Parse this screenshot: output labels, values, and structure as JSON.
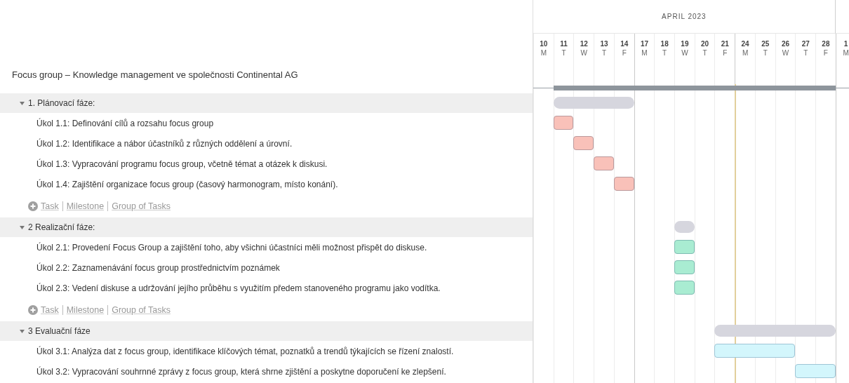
{
  "months": [
    {
      "label": "APRIL 2023"
    }
  ],
  "days": [
    {
      "day": "10",
      "weekday": "M"
    },
    {
      "day": "11",
      "weekday": "T"
    },
    {
      "day": "12",
      "weekday": "W"
    },
    {
      "day": "13",
      "weekday": "T"
    },
    {
      "day": "14",
      "weekday": "F"
    },
    {
      "day": "17",
      "weekday": "M"
    },
    {
      "day": "18",
      "weekday": "T"
    },
    {
      "day": "19",
      "weekday": "W"
    },
    {
      "day": "20",
      "weekday": "T"
    },
    {
      "day": "21",
      "weekday": "F"
    },
    {
      "day": "24",
      "weekday": "M"
    },
    {
      "day": "25",
      "weekday": "T"
    },
    {
      "day": "26",
      "weekday": "W"
    },
    {
      "day": "27",
      "weekday": "T"
    },
    {
      "day": "28",
      "weekday": "F"
    },
    {
      "day": "1",
      "weekday": "M"
    }
  ],
  "project": {
    "title": "Focus group – Knowledge management ve společnosti Continental AG"
  },
  "groups": [
    {
      "label": "1. Plánovací fáze:",
      "expanded": true,
      "tasks": [
        {
          "label": "Úkol 1.1: Definování cílů a rozsahu focus group",
          "color": "#f9c1b9"
        },
        {
          "label": "Úkol 1.2: Identifikace a nábor účastníků z různých oddělení a úrovní.",
          "color": "#f9c1b9"
        },
        {
          "label": "Úkol 1.3: Vypracování programu focus group, včetně témat a otázek k diskusi.",
          "color": "#f9c1b9"
        },
        {
          "label": "Úkol 1.4: Zajištění organizace focus group (časový harmonogram, místo konání).",
          "color": "#f9c1b9"
        }
      ],
      "add_links": [
        "Task",
        "Milestone",
        "Group of Tasks"
      ]
    },
    {
      "label": "2 Realizační fáze:",
      "expanded": true,
      "tasks": [
        {
          "label": "Úkol 2.1: Provedení Focus Group a zajištění toho, aby všichni účastníci měli možnost přispět do diskuse.",
          "color": "#a9ecd2"
        },
        {
          "label": "Úkol 2.2: Zaznamenávání focus group prostřednictvím poznámek",
          "color": "#a9ecd2"
        },
        {
          "label": "Úkol 2.3: Vedení diskuse a udržování jejího průběhu s využitím předem stanoveného programu jako vodítka.",
          "color": "#a9ecd2"
        }
      ],
      "add_links": [
        "Task",
        "Milestone",
        "Group of Tasks"
      ]
    },
    {
      "label": "3 Evaluační fáze",
      "expanded": true,
      "tasks": [
        {
          "label": "Úkol 3.1: Analýza dat z focus group, identifikace klíčových témat, poznatků a trendů týkajících se řízení znalostí.",
          "color": "#d3f6fc"
        },
        {
          "label": "Úkol 3.2: Vypracování souhrnné zprávy z focus group, která shrne zjištění a poskytne doporučení ke zlepšení.",
          "color": "#d3f6fc"
        }
      ]
    }
  ]
}
